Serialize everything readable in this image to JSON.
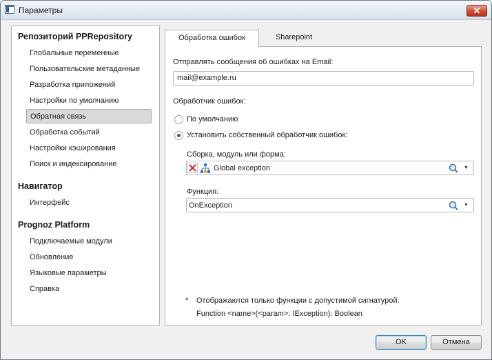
{
  "window": {
    "title": "Параметры",
    "close_glyph": "✕"
  },
  "sidebar": {
    "sections": [
      {
        "title": "Репозиторий PPRepository",
        "items": [
          "Глобальные переменные",
          "Пользовательские метаданные",
          "Разработка приложений",
          "Настройки по умолчанию",
          "Обратная связь",
          "Обработка событий",
          "Настройки кэширования",
          "Поиск и индексирование"
        ]
      },
      {
        "title": "Навигатор",
        "items": [
          "Интерфейс"
        ]
      },
      {
        "title": "Prognoz Platform",
        "items": [
          "Подключаемые модули",
          "Обновление",
          "Языковые параметры",
          "Справка"
        ]
      }
    ],
    "selected_item": "Обратная связь"
  },
  "tabs": [
    {
      "label": "Обработка ошибок",
      "active": true
    },
    {
      "label": "Sharepoint",
      "active": false
    }
  ],
  "form": {
    "email_label": "Отправлять сообщения об ошибках на Email:",
    "email_value": "mail@example.ru",
    "handler_label": "Обработчик ошибок:",
    "radio_default_label": "По умолчанию",
    "radio_custom_label": "Установить собственный обработчик ошибок:",
    "selected_radio": "custom",
    "assembly_label": "Сборка, модуль или форма:",
    "assembly_value": "Global exception",
    "function_label": "Функция:",
    "function_value": "OnException",
    "footnote_star": "*",
    "footnote_line1": "Отображаются только функции с допустимой сигнатурой:",
    "footnote_line2": "Function <name>(<param>: IException): Boolean"
  },
  "buttons": {
    "ok": "OK",
    "cancel": "Отмена"
  },
  "icons": {
    "clear": "clear-red-x-icon",
    "tree": "hierarchy-tree-icon",
    "search": "magnifier-icon",
    "dropdown": "triangle-down-icon",
    "dropdown_glyph": "▼"
  },
  "colors": {
    "selection": "#d9d9d9",
    "close_button": "#c7432b",
    "icon_blue": "#3b73b9",
    "clear_red": "#d2232a"
  }
}
